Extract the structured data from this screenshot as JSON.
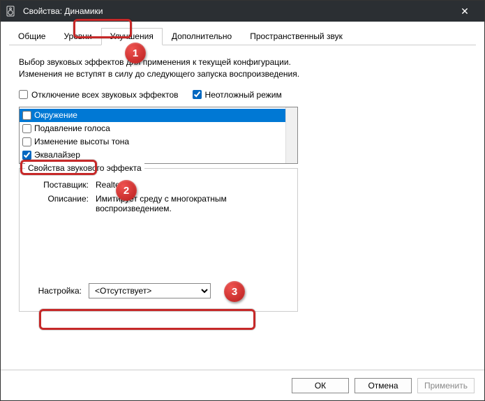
{
  "titlebar": {
    "title": "Свойства: Динамики",
    "close": "✕"
  },
  "tabs": {
    "general": "Общие",
    "levels": "Уровни",
    "enhance": "Улучшения",
    "advanced": "Дополнительно",
    "spatial": "Пространственный звук"
  },
  "panel": {
    "description": "Выбор звуковых эффектов для применения к текущей конфигурации. Изменения не вступят в силу до следующего запуска воспроизведения.",
    "disable_all": "Отключение всех звуковых эффектов",
    "urgent": "Неотложный режим"
  },
  "effects": {
    "surround": "Окружение",
    "voice": "Подавление голоса",
    "pitch": "Изменение высоты тона",
    "eq": "Эквалайзер"
  },
  "props": {
    "legend": "Свойства звукового эффекта",
    "vendor_k": "Поставщик:",
    "vendor_v": "Realtek",
    "desc_k": "Описание:",
    "desc_v": "Имитирует среду с многократным воспроизведением.",
    "setting_k": "Настройка:",
    "setting_v": "<Отсутствует>"
  },
  "footer": {
    "ok": "ОК",
    "cancel": "Отмена",
    "apply": "Применить"
  },
  "badges": {
    "b1": "1",
    "b2": "2",
    "b3": "3"
  }
}
